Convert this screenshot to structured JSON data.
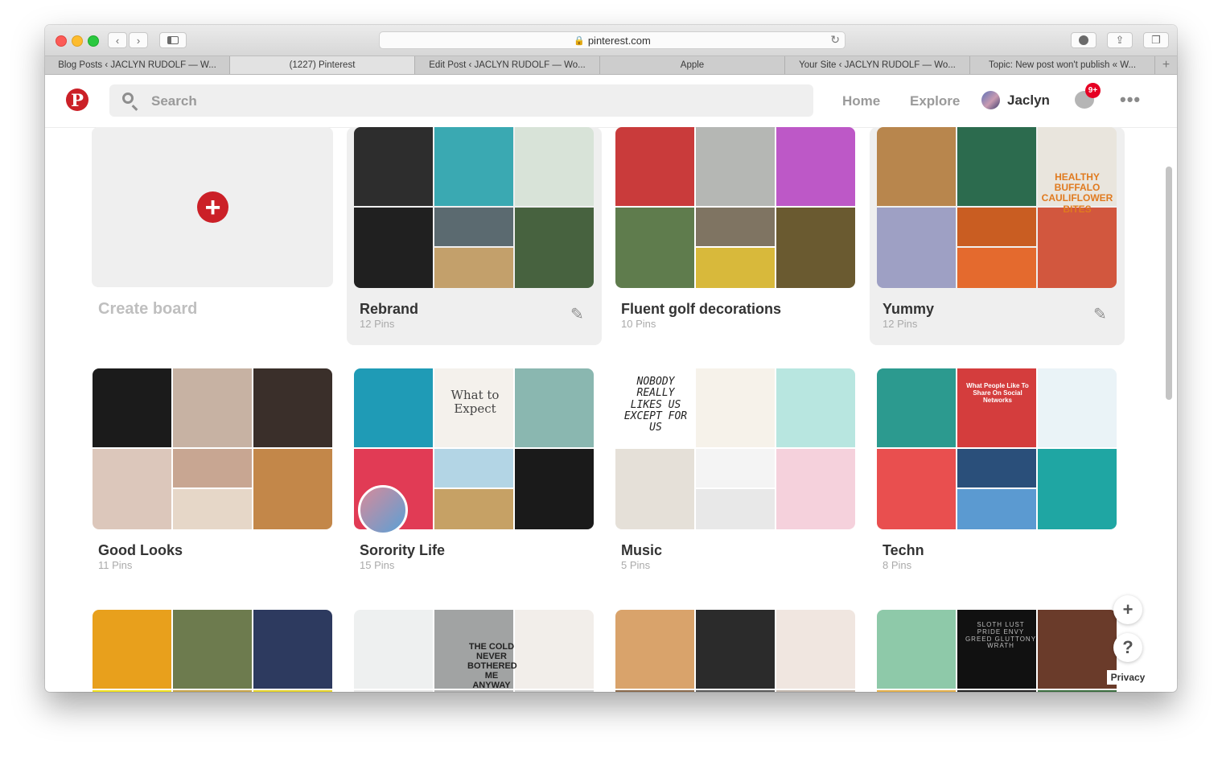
{
  "browser": {
    "url": "pinterest.com",
    "tabs": [
      {
        "label": "Blog Posts ‹ JACLYN RUDOLF — W...",
        "active": false
      },
      {
        "label": "(1227) Pinterest",
        "active": true
      },
      {
        "label": "Edit Post ‹ JACLYN RUDOLF — Wo...",
        "active": false
      },
      {
        "label": "Apple",
        "active": false
      },
      {
        "label": "Your Site ‹ JACLYN RUDOLF — Wo...",
        "active": false
      },
      {
        "label": "Topic: New post won't publish « W...",
        "active": false
      }
    ]
  },
  "header": {
    "logo_glyph": "P",
    "search_placeholder": "Search",
    "nav": {
      "home": "Home",
      "explore": "Explore"
    },
    "user": "Jaclyn",
    "notification_badge": "9+",
    "more": "•••"
  },
  "create_board": {
    "plus": "+",
    "label": "Create board"
  },
  "boards": [
    {
      "title": "Rebrand",
      "pins": "12 Pins",
      "editable": true,
      "overlay": "",
      "colors": [
        "#2d2d2d",
        "#3aa9b2",
        "#d8e3d8",
        "#202020",
        "#5b6a70",
        "#c3a06b",
        "#47623f"
      ]
    },
    {
      "title": "Fluent golf decorations",
      "pins": "10 Pins",
      "editable": false,
      "overlay": "",
      "colors": [
        "#c93b3b",
        "#b5b7b4",
        "#bd58c7",
        "#5f7c4d",
        "#7f7462",
        "#d8b93b",
        "#6a5a30"
      ]
    },
    {
      "title": "Yummy",
      "pins": "12 Pins",
      "editable": true,
      "overlay": "HEALTHY BUFFALO CAULIFLOWER BITES",
      "colors": [
        "#b8864d",
        "#2c6b4e",
        "#e9e5dd",
        "#9ea0c4",
        "#c95d22",
        "#e46a2e",
        "#d2573e"
      ]
    },
    {
      "title": "Good Looks",
      "pins": "11 Pins",
      "editable": false,
      "overlay": "",
      "colors": [
        "#1b1b1b",
        "#c7b2a3",
        "#3a2f2a",
        "#dcc7bb",
        "#c8a692",
        "#e6d7c8",
        "#c38749"
      ]
    },
    {
      "title": "Sorority Life",
      "pins": "15 Pins",
      "editable": false,
      "overlay": "What to Expect",
      "colors": [
        "#1f9bb6",
        "#f4f1ec",
        "#8ab7b0",
        "#e13b55",
        "#b3d5e5",
        "#c6a165",
        "#1a1a1a"
      ]
    },
    {
      "title": "Music",
      "pins": "5 Pins",
      "editable": false,
      "overlay": "NOBODY REALLY LIKES US EXCEPT FOR US",
      "colors": [
        "#ffffff",
        "#f6f2ea",
        "#b8e6e0",
        "#e5e0d8",
        "#f4f4f4",
        "#e8e8e8",
        "#f5d1dc"
      ]
    },
    {
      "title": "Techn",
      "pins": "8 Pins",
      "editable": false,
      "overlay": "What People Like To Share On Social Networks",
      "colors": [
        "#2c9a8f",
        "#d43d3d",
        "#eaf3f7",
        "#e94f4f",
        "#2a4f7a",
        "#5b9ad1",
        "#1fa6a3"
      ]
    },
    {
      "title": "",
      "pins": "",
      "editable": false,
      "overlay": "",
      "colors": [
        "#e8a01c",
        "#6d7b4e",
        "#2d3a5f",
        "#f2e21f",
        "#c8a54a",
        "#b79363",
        "#e6d42a"
      ]
    },
    {
      "title": "",
      "pins": "",
      "editable": false,
      "overlay": "THE COLD NEVER BOTHERED ME ANYWAY",
      "colors": [
        "#eef0f0",
        "#a1a3a3",
        "#f2eeea",
        "#e8e8e8",
        "#b5b5b5",
        "#e2dcd6",
        "#d0d0d0"
      ]
    },
    {
      "title": "",
      "pins": "",
      "editable": false,
      "overlay": "",
      "colors": [
        "#d9a36b",
        "#2b2b2b",
        "#f0e6e0",
        "#8a6a4c",
        "#5a5a5a",
        "#e7d8cc",
        "#c2b7ad"
      ]
    },
    {
      "title": "",
      "pins": "",
      "editable": false,
      "overlay": "SLOTH LUST PRIDE ENVY GREED GLUTTONY WRATH",
      "colors": [
        "#8ec9a9",
        "#111111",
        "#6a3b2a",
        "#e4b04b",
        "#222222",
        "#a0712c",
        "#3b6d3f"
      ]
    }
  ],
  "floating": {
    "add": "+",
    "help": "?",
    "privacy": "Privacy"
  }
}
